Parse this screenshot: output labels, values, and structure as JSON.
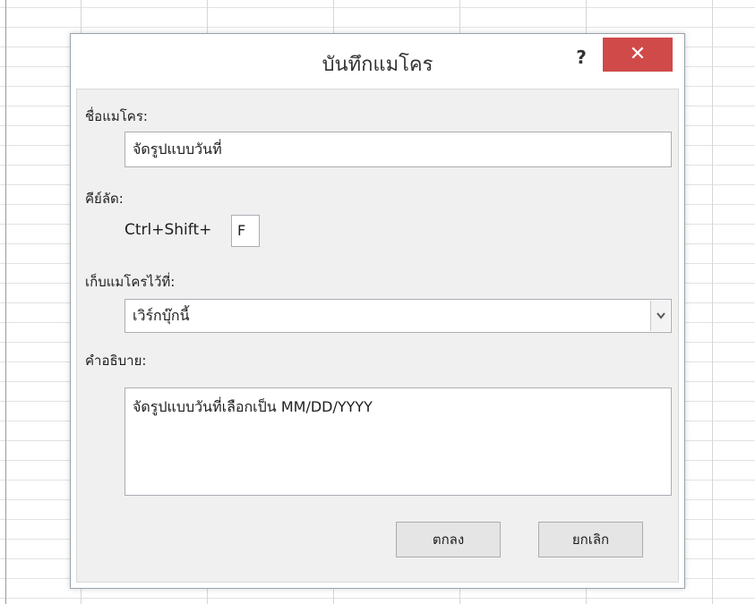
{
  "dialog": {
    "title": "บันทึกแมโคร",
    "help_label": "?",
    "close_label": "✕"
  },
  "macro_name": {
    "label": "ชื่อแมโคร:",
    "value": "จัดรูปแบบวันที่"
  },
  "shortcut": {
    "label": "คีย์ลัด:",
    "prefix": "Ctrl+Shift+",
    "key": "F"
  },
  "store_in": {
    "label": "เก็บแมโครไว้ที่:",
    "value": "เวิร์กบุ๊กนี้"
  },
  "description": {
    "label": "คำอธิบาย:",
    "value": "จัดรูปแบบวันที่เลือกเป็น MM/DD/YYYY"
  },
  "buttons": {
    "ok_label": "ตกลง",
    "cancel_label": "ยกเลิก"
  },
  "colors": {
    "close_button": "#d04a4a",
    "panel": "#f0f0f0",
    "field_border": "#abadb3"
  }
}
